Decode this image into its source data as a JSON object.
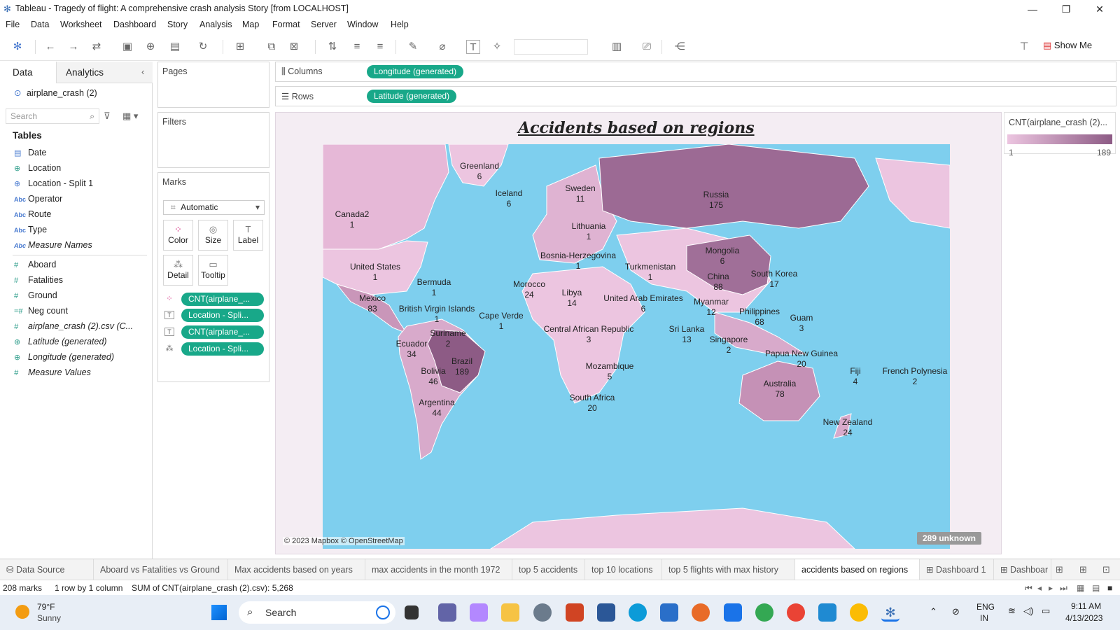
{
  "window": {
    "title": "Tableau - Tragedy of flight: A comprehensive crash analysis Story [from LOCALHOST]"
  },
  "menu": [
    "File",
    "Data",
    "Worksheet",
    "Dashboard",
    "Story",
    "Analysis",
    "Map",
    "Format",
    "Server",
    "Window",
    "Help"
  ],
  "toolbar": {
    "show_me": "Show Me"
  },
  "data_pane": {
    "tab_data": "Data",
    "tab_analytics": "Analytics",
    "datasource": "airplane_crash (2)",
    "search_placeholder": "Search",
    "tables_label": "Tables",
    "fields": [
      "Date",
      "Location",
      "Location - Split 1",
      "Operator",
      "Route",
      "Type",
      "Measure Names",
      "Aboard",
      "Fatalities",
      "Ground",
      "Neg count",
      "airplane_crash (2).csv (C...",
      "Latitude (generated)",
      "Longitude (generated)",
      "Measure Values"
    ]
  },
  "cards": {
    "pages": "Pages",
    "filters": "Filters",
    "marks": "Marks",
    "mark_type": "Automatic",
    "mark_buttons": [
      "Color",
      "Size",
      "Label",
      "Detail",
      "Tooltip"
    ],
    "pills": [
      "CNT(airplane_...",
      "Location - Spli...",
      "CNT(airplane_...",
      "Location - Spli..."
    ]
  },
  "shelves": {
    "columns_label": "Columns",
    "columns_pill": "Longitude (generated)",
    "rows_label": "Rows",
    "rows_pill": "Latitude (generated)"
  },
  "viz": {
    "title": "Accidents based on regions",
    "attribution": "© 2023 Mapbox © OpenStreetMap",
    "unknown": "289 unknown",
    "labels": [
      {
        "name": "Greenland",
        "value": "6"
      },
      {
        "name": "Iceland",
        "value": "6"
      },
      {
        "name": "Sweden",
        "value": "11"
      },
      {
        "name": "Russia",
        "value": "175"
      },
      {
        "name": "Canada2",
        "value": "1"
      },
      {
        "name": "Lithuania",
        "value": "1"
      },
      {
        "name": "Bosnia-Herzegovina",
        "value": "1"
      },
      {
        "name": "Mongolia",
        "value": "6"
      },
      {
        "name": "Turkmenistan",
        "value": "1"
      },
      {
        "name": "United States",
        "value": "1"
      },
      {
        "name": "China",
        "value": "88"
      },
      {
        "name": "South Korea",
        "value": "17"
      },
      {
        "name": "Bermuda",
        "value": "1"
      },
      {
        "name": "Morocco",
        "value": "24"
      },
      {
        "name": "Libya",
        "value": "14"
      },
      {
        "name": "United Arab Emirates",
        "value": "6"
      },
      {
        "name": "Mexico",
        "value": "83"
      },
      {
        "name": "Myanmar",
        "value": "12"
      },
      {
        "name": "Philippines",
        "value": "68"
      },
      {
        "name": "British Virgin Islands",
        "value": "1"
      },
      {
        "name": "Cape Verde",
        "value": "1"
      },
      {
        "name": "Guam",
        "value": "3"
      },
      {
        "name": "Central African Republic",
        "value": "3"
      },
      {
        "name": "Sri Lanka",
        "value": "13"
      },
      {
        "name": "Suriname",
        "value": "2"
      },
      {
        "name": "Singapore",
        "value": "2"
      },
      {
        "name": "Ecuador",
        "value": "34"
      },
      {
        "name": "Papua New Guinea",
        "value": "20"
      },
      {
        "name": "Brazil",
        "value": "189"
      },
      {
        "name": "Mozambique",
        "value": "5"
      },
      {
        "name": "Fiji",
        "value": "4"
      },
      {
        "name": "French Polynesia",
        "value": "2"
      },
      {
        "name": "Bolivia",
        "value": "46"
      },
      {
        "name": "Australia",
        "value": "78"
      },
      {
        "name": "South Africa",
        "value": "20"
      },
      {
        "name": "Argentina",
        "value": "44"
      },
      {
        "name": "New Zealand",
        "value": "24"
      }
    ]
  },
  "legend": {
    "title": "CNT(airplane_crash (2)...",
    "min": "1",
    "max": "189",
    "color_low": "#ecc5e0",
    "color_high": "#8d5b85"
  },
  "sheet_tabs": [
    "Data Source",
    "Aboard vs Fatalities vs Ground",
    "Max accidents based on years",
    "max accidents in the month 1972",
    "top 5 accidents",
    "top 10 locations",
    "top 5 flights with max history",
    "accidents based on regions",
    "Dashboard 1",
    "Dashboar"
  ],
  "status": {
    "marks": "208 marks",
    "rows": "1 row by 1 column",
    "sum": "SUM of CNT(airplane_crash (2).csv): 5,268"
  },
  "taskbar": {
    "temp": "79°F",
    "weather": "Sunny",
    "search": "Search",
    "lang1": "ENG",
    "lang2": "IN",
    "time": "9:11 AM",
    "date": "4/13/2023"
  }
}
